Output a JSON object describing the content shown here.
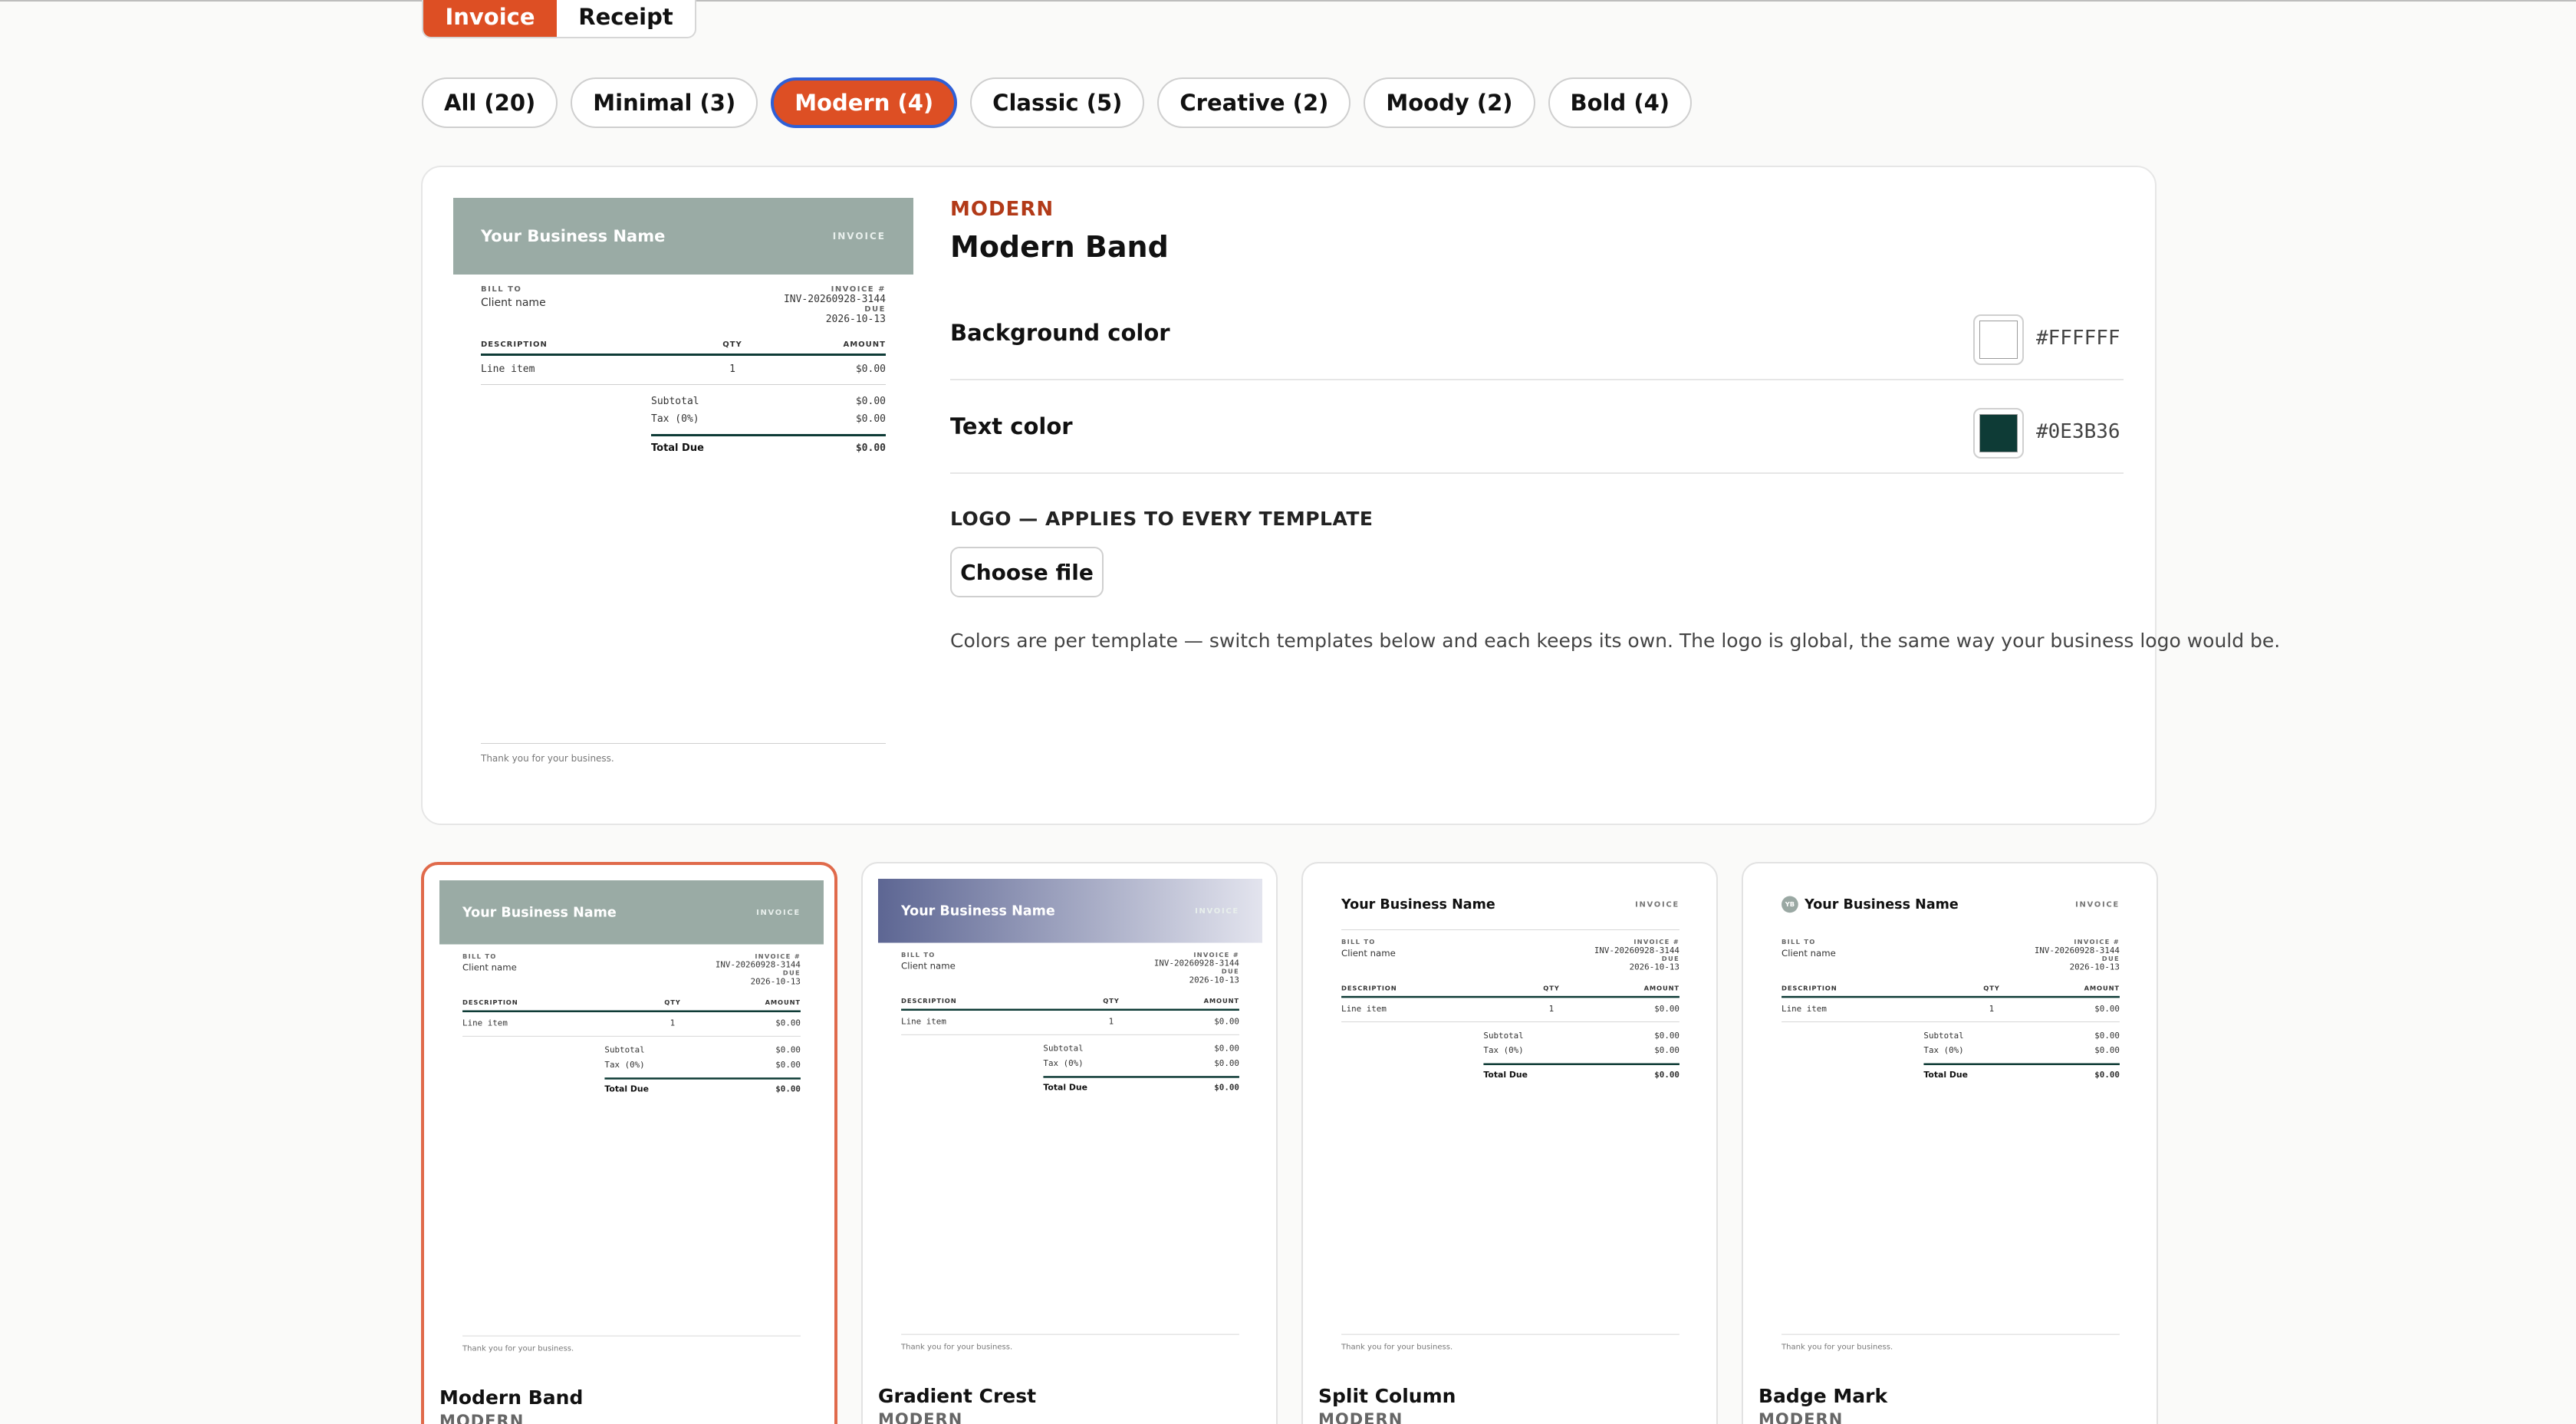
{
  "doc_types": {
    "invoice": "Invoice",
    "receipt": "Receipt"
  },
  "filters": [
    "All (20)",
    "Minimal (3)",
    "Modern (4)",
    "Classic (5)",
    "Creative (2)",
    "Moody (2)",
    "Bold (4)"
  ],
  "editor": {
    "category": "MODERN",
    "title": "Modern Band",
    "background_label": "Background color",
    "background_hex": "#FFFFFF",
    "text_label": "Text color",
    "text_hex": "#0E3B36",
    "logo_label": "LOGO — APPLIES TO EVERY TEMPLATE",
    "choose_file": "Choose file",
    "note": "Colors are per template — switch templates below and each keeps its own. The logo is global, the same way your business logo would be."
  },
  "invoice_sample": {
    "business": "Your Business Name",
    "tag": "INVOICE",
    "bill_to": "BILL TO",
    "client": "Client name",
    "invoice_no_label": "INVOICE #",
    "invoice_no": "INV-20260928-3144",
    "due_label": "DUE",
    "due": "2026-10-13",
    "col_desc": "DESCRIPTION",
    "col_qty": "QTY",
    "col_amount": "AMOUNT",
    "item": "Line item",
    "qty": "1",
    "amount": "$0.00",
    "subtotal_label": "Subtotal",
    "subtotal": "$0.00",
    "tax_label": "Tax (0%)",
    "tax": "$0.00",
    "total_label": "Total Due",
    "total": "$0.00",
    "footer": "Thank you for your business.",
    "badge_initials": "YB"
  },
  "colors": {
    "accent": "#dd4f24",
    "band_modern": "#9aaba5",
    "band_gradient_start": "#5d6693",
    "band_gradient_end": "#e3e4ee",
    "text": "#0E3B36"
  },
  "cards": [
    {
      "name": "Modern Band",
      "category": "MODERN",
      "style": "modern"
    },
    {
      "name": "Gradient Crest",
      "category": "MODERN",
      "style": "gradient"
    },
    {
      "name": "Split Column",
      "category": "MODERN",
      "style": "split"
    },
    {
      "name": "Badge Mark",
      "category": "MODERN",
      "style": "badge"
    }
  ]
}
